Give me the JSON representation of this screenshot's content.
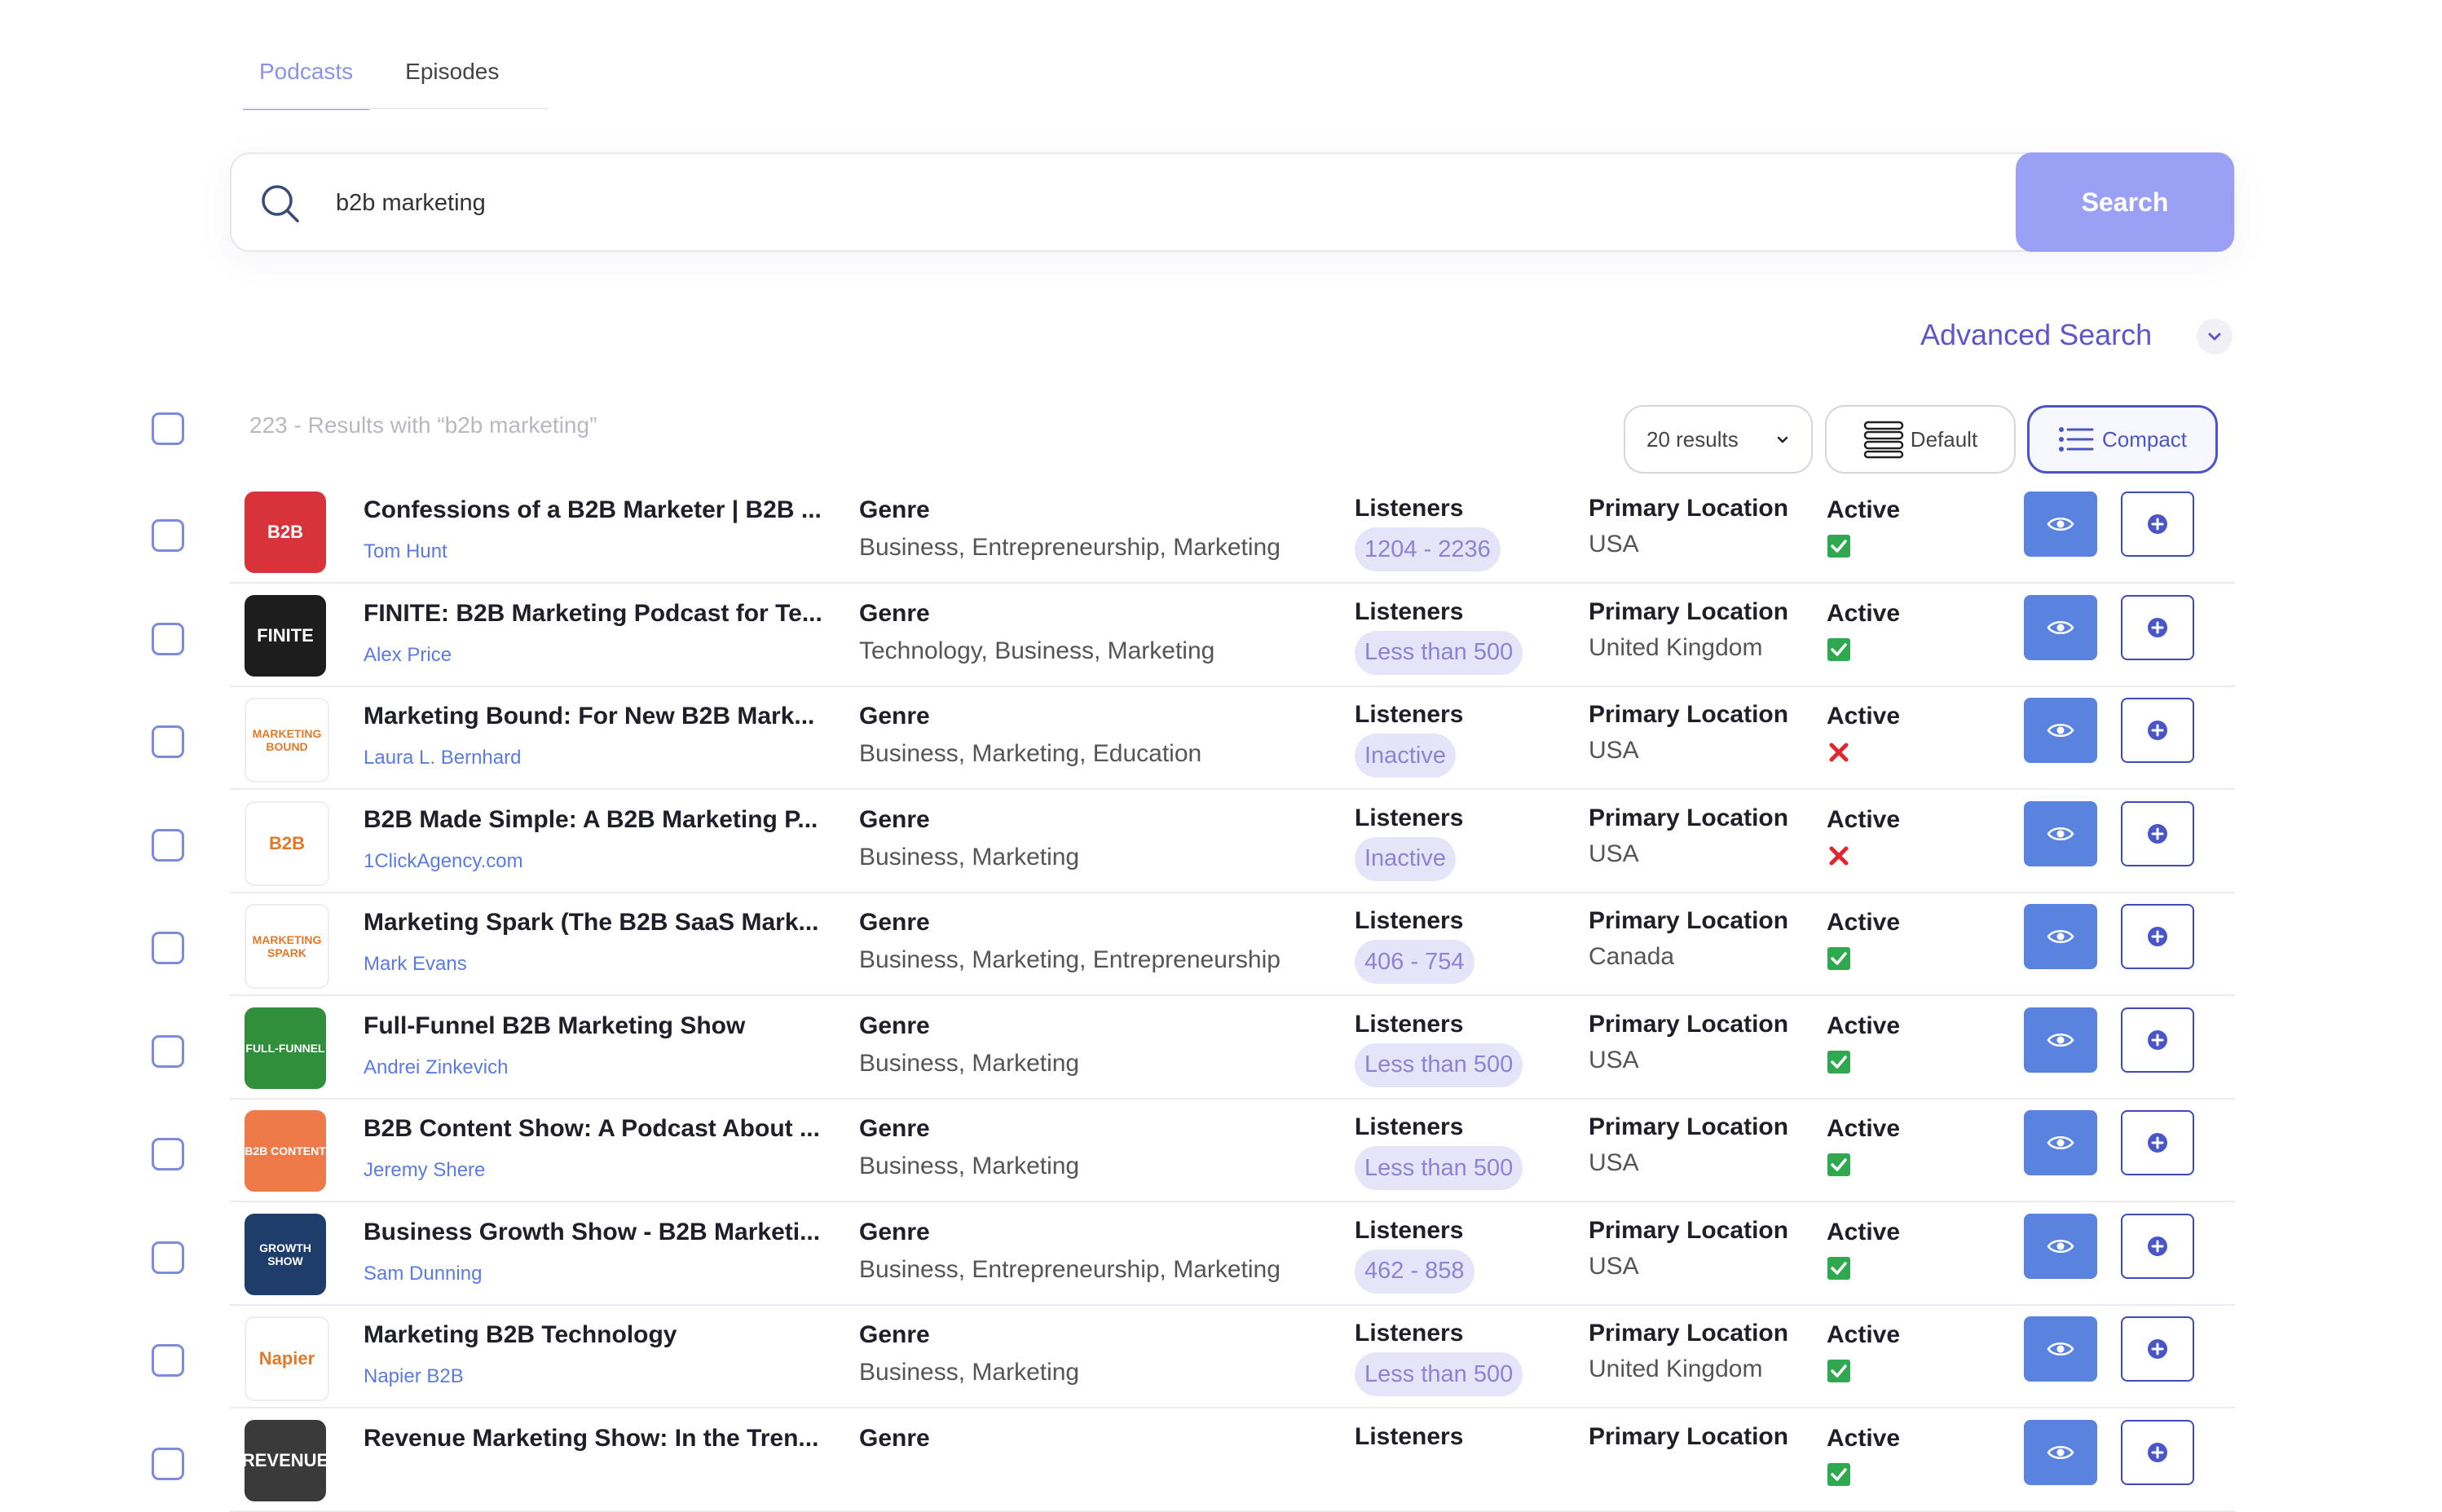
{
  "tabs": [
    {
      "label": "Podcasts",
      "active": true
    },
    {
      "label": "Episodes",
      "active": false
    }
  ],
  "search": {
    "query": "b2b marketing",
    "button": "Search"
  },
  "advanced": {
    "label": "Advanced Search"
  },
  "results": {
    "summary": "223 - Results with “b2b marketing”",
    "per_page": "20 results",
    "view_default": "Default",
    "view_compact": "Compact"
  },
  "column_labels": {
    "genre": "Genre",
    "listeners": "Listeners",
    "location": "Primary Location",
    "active": "Active"
  },
  "podcasts": [
    {
      "title": "Confessions of a B2B Marketer | B2B ...",
      "author": "Tom Hunt",
      "genre": "Business, Entrepreneurship, Marketing",
      "listeners": "1204 - 2236",
      "location": "USA",
      "active": true,
      "cover_text": "B2B",
      "cover_bg": "#d8323a"
    },
    {
      "title": "FINITE: B2B Marketing Podcast for Te...",
      "author": "Alex Price",
      "genre": "Technology, Business, Marketing",
      "listeners": "Less than 500",
      "location": "United Kingdom",
      "active": true,
      "cover_text": "FINITE",
      "cover_bg": "#1d1d1d"
    },
    {
      "title": "Marketing Bound: For New B2B Mark...",
      "author": "Laura L. Bernhard",
      "genre": "Business, Marketing, Education",
      "listeners": "Inactive",
      "location": "USA",
      "active": false,
      "cover_text": "MARKETING BOUND",
      "cover_bg": "#ffffff"
    },
    {
      "title": "B2B Made Simple: A B2B Marketing P...",
      "author": "1ClickAgency.com",
      "genre": "Business, Marketing",
      "listeners": "Inactive",
      "location": "USA",
      "active": false,
      "cover_text": "B2B",
      "cover_bg": "#ffffff"
    },
    {
      "title": "Marketing Spark (The B2B SaaS Mark...",
      "author": "Mark Evans",
      "genre": "Business, Marketing, Entrepreneurship",
      "listeners": "406 - 754",
      "location": "Canada",
      "active": true,
      "cover_text": "MARKETING SPARK",
      "cover_bg": "#ffffff"
    },
    {
      "title": "Full-Funnel B2B Marketing Show",
      "author": "Andrei Zinkevich",
      "genre": "Business, Marketing",
      "listeners": "Less than 500",
      "location": "USA",
      "active": true,
      "cover_text": "FULL-FUNNEL",
      "cover_bg": "#2f8f3a"
    },
    {
      "title": "B2B Content Show: A Podcast About ...",
      "author": "Jeremy Shere",
      "genre": "Business, Marketing",
      "listeners": "Less than 500",
      "location": "USA",
      "active": true,
      "cover_text": "B2B CONTENT",
      "cover_bg": "#ee7a4a"
    },
    {
      "title": "Business Growth Show - B2B Marketi...",
      "author": "Sam Dunning",
      "genre": "Business, Entrepreneurship, Marketing",
      "listeners": "462 - 858",
      "location": "USA",
      "active": true,
      "cover_text": "GROWTH SHOW",
      "cover_bg": "#1e3d6b"
    },
    {
      "title": "Marketing B2B Technology",
      "author": "Napier B2B",
      "genre": "Business, Marketing",
      "listeners": "Less than 500",
      "location": "United Kingdom",
      "active": true,
      "cover_text": "Napier",
      "cover_bg": "#ffffff"
    },
    {
      "title": "Revenue Marketing Show: In the Tren...",
      "author": "",
      "genre": "",
      "listeners": "",
      "location": "",
      "active": true,
      "cover_text": "REVENUE",
      "cover_bg": "#3a3a3a"
    }
  ],
  "colors": {
    "accent": "#5f57c9",
    "search_button": "#9aa0f4",
    "eye_button": "#5a83e0",
    "check": "#2fa84f",
    "cross": "#e0262e"
  }
}
